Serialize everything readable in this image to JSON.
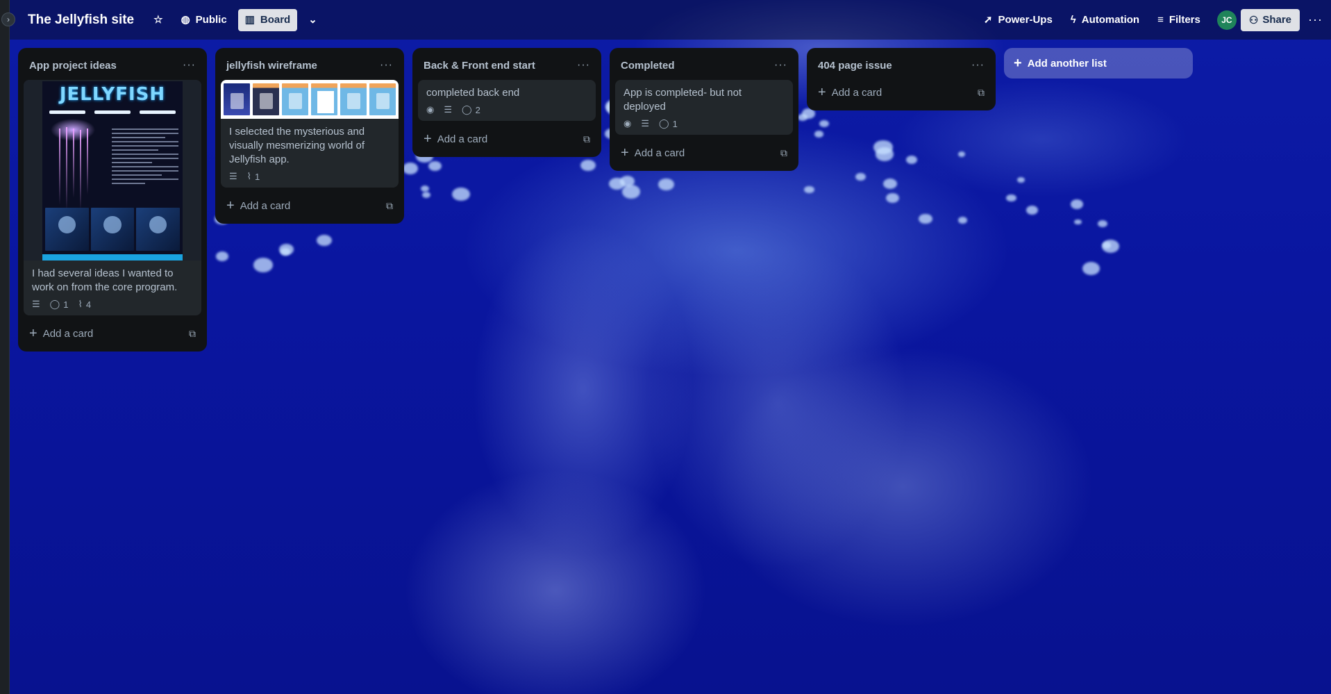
{
  "board": {
    "title": "The Jellyfish site",
    "visibility_label": "Public",
    "view_label": "Board"
  },
  "header": {
    "power_ups_label": "Power-Ups",
    "automation_label": "Automation",
    "filters_label": "Filters",
    "avatar_initials": "JC",
    "share_label": "Share"
  },
  "lists": [
    {
      "title": "App project ideas",
      "cards": [
        {
          "cover": "jellyfish-poster",
          "cover_title": "JELLYFISH",
          "text": "I had several ideas I wanted to work on from the core program.",
          "comments": "1",
          "attachments": "4"
        }
      ],
      "add_label": "Add a card"
    },
    {
      "title": "jellyfish wireframe",
      "cards": [
        {
          "cover": "wireframe-thumbnails",
          "text": "I selected the mysterious and visually mesmerizing world of Jellyfish app.",
          "attachments": "1"
        }
      ],
      "add_label": "Add a card"
    },
    {
      "title": "Back & Front end start",
      "cards": [
        {
          "text": "completed back end",
          "comments": "2"
        }
      ],
      "add_label": "Add a card"
    },
    {
      "title": "Completed",
      "cards": [
        {
          "text": "App is completed- but not deployed",
          "comments": "1"
        }
      ],
      "add_label": "Add a card"
    },
    {
      "title": "404 page issue",
      "cards": [],
      "add_label": "Add a card"
    }
  ],
  "add_list_label": "Add another list",
  "colors": {
    "list_bg": "#111315",
    "card_bg": "#22272b",
    "text": "#b6c2cf",
    "avatar": "#1f845a",
    "board_bg": "#0b1aa8"
  }
}
